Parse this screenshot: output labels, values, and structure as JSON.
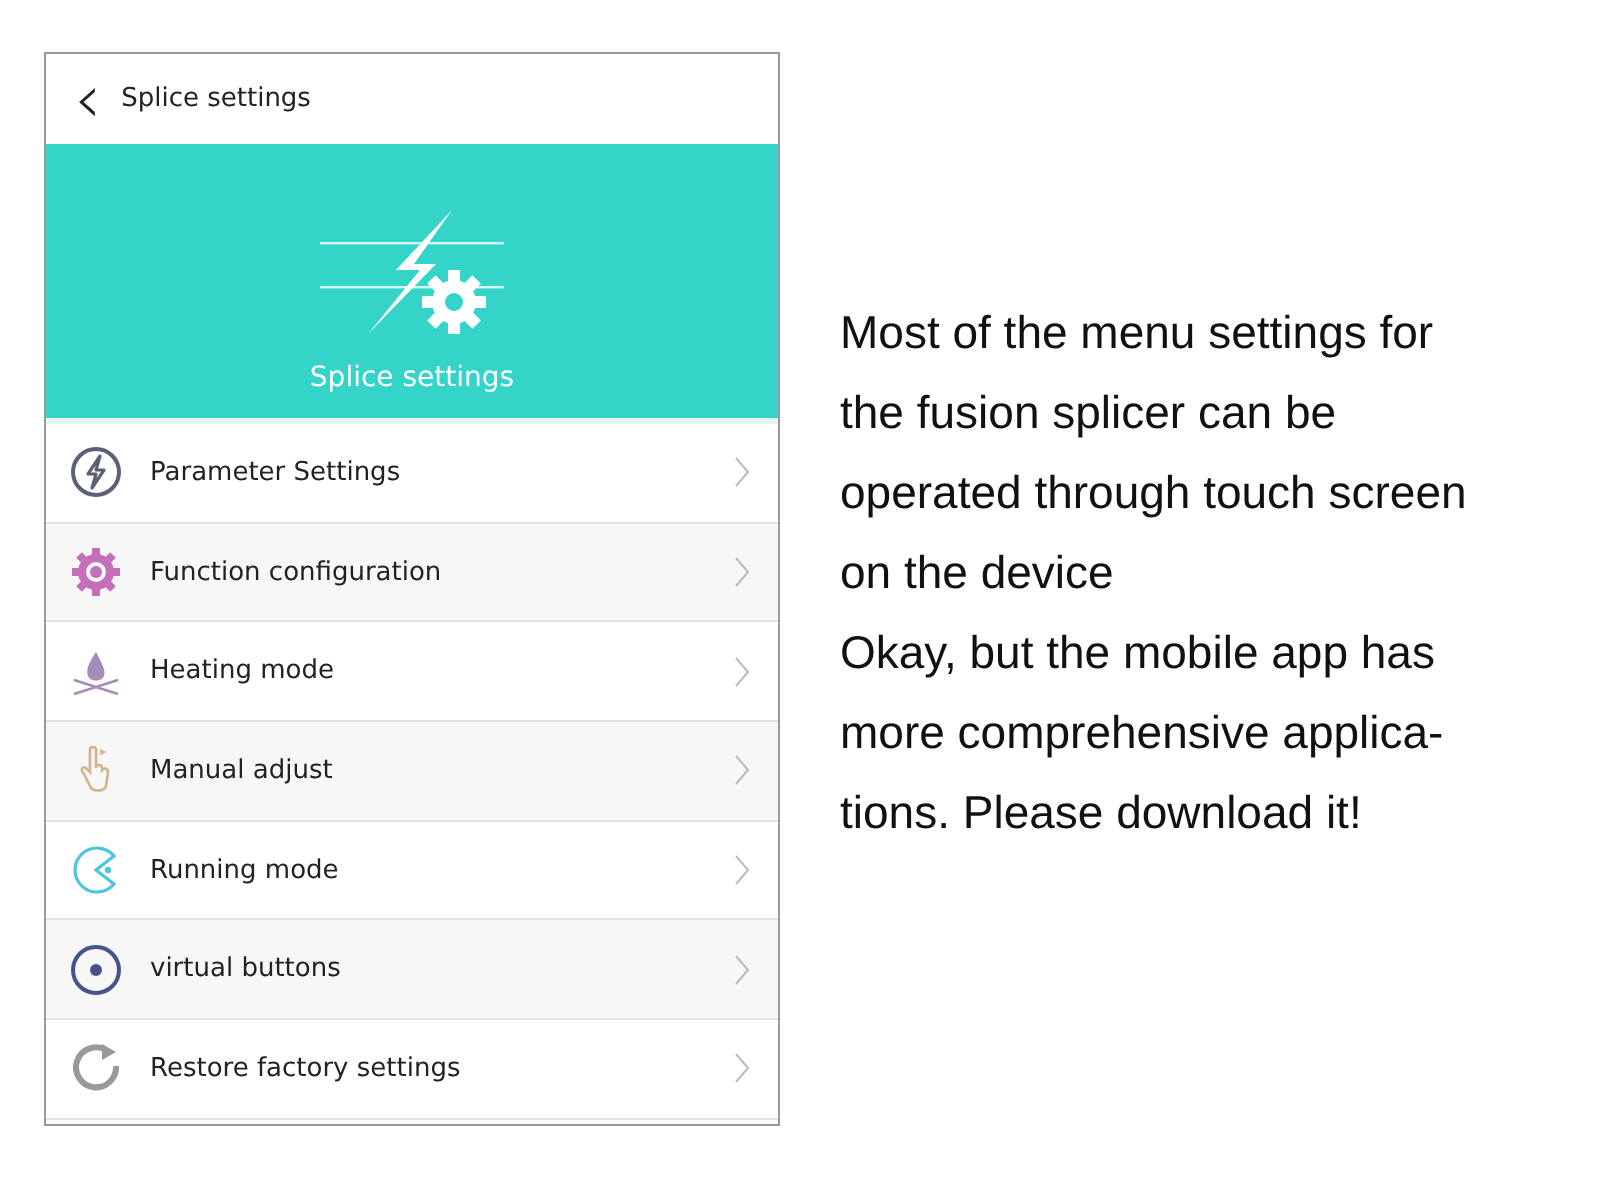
{
  "header": {
    "back_icon": "‹",
    "title": "Splice settings"
  },
  "banner": {
    "title": "Splice settings"
  },
  "menu": [
    {
      "label": "Parameter Settings",
      "kind": "bolt",
      "color": "#5a6075"
    },
    {
      "label": "Function configuration",
      "kind": "gear",
      "color": "#c46fba"
    },
    {
      "label": "Heating mode",
      "kind": "flame",
      "color": "#a68cb8"
    },
    {
      "label": "Manual adjust",
      "kind": "hand",
      "color": "#d2b48c"
    },
    {
      "label": "Running mode",
      "kind": "pacman",
      "color": "#4cc6dd"
    },
    {
      "label": "virtual buttons",
      "kind": "target",
      "color": "#44538c"
    },
    {
      "label": "Restore factory settings",
      "kind": "refresh",
      "color": "#999999"
    }
  ],
  "caption": [
    {
      "lines": [
        "Most of the menu settings for",
        "the fusion splicer can be",
        "operated through touch screen",
        "on the device"
      ]
    },
    {
      "lines": [
        "Okay, but the mobile app has",
        "more comprehensive applica-",
        "tions. Please download it!"
      ]
    }
  ]
}
